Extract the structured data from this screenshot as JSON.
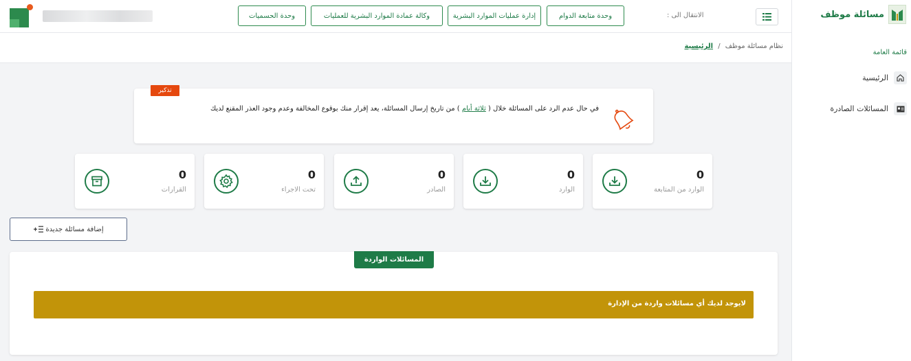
{
  "sidebar": {
    "title": "مسائلة موظف",
    "section_label": "قائمة العامة",
    "items": [
      {
        "label": "الرئيسية",
        "icon": "home-icon"
      },
      {
        "label": "المسائلات الصادرة",
        "icon": "id-card-icon"
      }
    ]
  },
  "topbar": {
    "nav_label": "الانتقال الى :",
    "menu_icon": "list-icon",
    "nav_buttons": [
      {
        "label": "وحدة متابعة الدوام"
      },
      {
        "label": "إدارة عمليات الموارد البشرية"
      },
      {
        "label": "وكالة عمادة الموارد البشرية للعمليات"
      },
      {
        "label": "وحدة الحسميات"
      }
    ]
  },
  "breadcrumb": {
    "root": "نظام مسائلة موظف",
    "separator": "/",
    "current": "الرئيسية"
  },
  "reminder": {
    "badge": "تذكير",
    "text_before": "في حال عدم الرد على المسائلة خلال (",
    "highlight": "ثلاثة أيام",
    "text_after": ") من تاريخ إرسال المسائلة، يعد إقرار منك بوقوع المخالفة وعدم وجود العذر المقنع لديك",
    "icon": "bell-icon"
  },
  "stats": [
    {
      "value": "0",
      "label": "الوارد من المتابعة",
      "icon": "download-icon"
    },
    {
      "value": "0",
      "label": "الوارد",
      "icon": "download-icon"
    },
    {
      "value": "0",
      "label": "الصادر",
      "icon": "upload-icon"
    },
    {
      "value": "0",
      "label": "تحت الاجراء",
      "icon": "gear-icon"
    },
    {
      "value": "0",
      "label": "القرارات",
      "icon": "archive-icon"
    }
  ],
  "add_button": {
    "label": "إضافة مسائلة جديدة",
    "icon": "add-list-icon"
  },
  "incoming": {
    "tab": "المسائلات الواردة",
    "empty_message": "لايوجد لديك أي مسائلات واردة من الإدارة"
  },
  "colors": {
    "primary": "#1e7b47",
    "reminder_badge": "#e5480e",
    "empty_bar": "#c29409"
  }
}
